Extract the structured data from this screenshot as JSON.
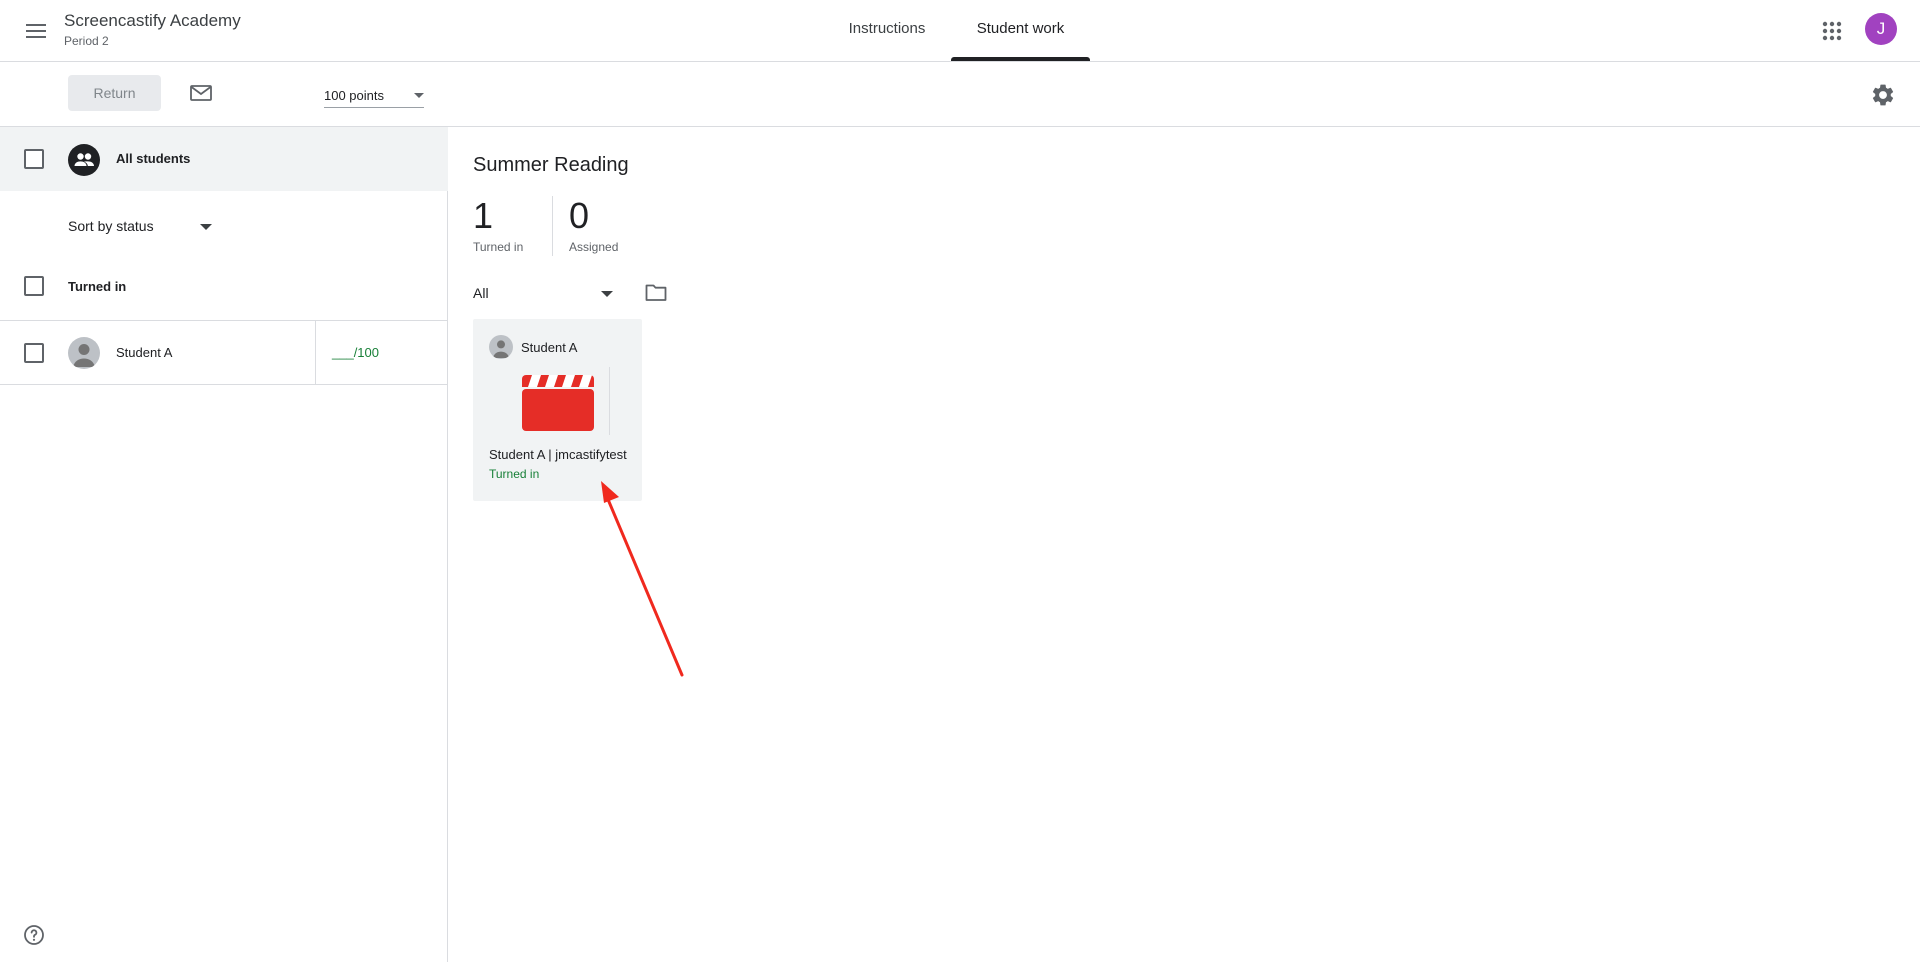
{
  "header": {
    "class_name": "Screencastify Academy",
    "class_section": "Period 2",
    "tabs": [
      {
        "label": "Instructions",
        "active": false
      },
      {
        "label": "Student work",
        "active": true
      }
    ],
    "user_initial": "J",
    "user_avatar_color": "#a142c0",
    "icons": [
      "hamburger-menu-icon",
      "google-apps-icon"
    ]
  },
  "toolbar": {
    "return_label": "Return",
    "points_value": "100 points",
    "icons": [
      "mail-icon",
      "settings-gear-icon"
    ]
  },
  "roster": {
    "all_students_label": "All students",
    "sort_label": "Sort by status",
    "groups": [
      {
        "heading": "Turned in",
        "students": [
          {
            "name": "Student A",
            "grade": "___/100"
          }
        ]
      }
    ],
    "help_icon": "help-circle-icon"
  },
  "assignment": {
    "title": "Summer Reading",
    "stats": [
      {
        "value": "1",
        "label": "Turned in"
      },
      {
        "value": "0",
        "label": "Assigned"
      }
    ],
    "filter_value": "All",
    "folder_icon": "folder-icon",
    "submissions": [
      {
        "student": "Student A",
        "file_name": "Student A | jmcastifytest",
        "status": "Turned in",
        "thumbnail_icon": "video-clapperboard-icon",
        "thumbnail_color": "#e52d27"
      }
    ]
  },
  "colors": {
    "accent_green": "#188038",
    "divider": "#dadce0",
    "annotation_red": "#f0291e"
  }
}
